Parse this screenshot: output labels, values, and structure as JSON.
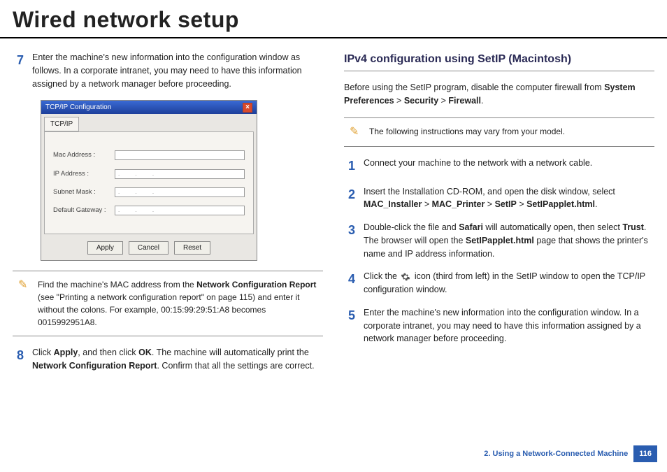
{
  "title": "Wired network setup",
  "left": {
    "step7": {
      "num": "7",
      "text": "Enter the machine's new information into the configuration window as follows. In a corporate intranet, you may need to have this information assigned by a network manager before proceeding."
    },
    "dialog": {
      "title": "TCP/IP Configuration",
      "tab": "TCP/IP",
      "rows": {
        "mac": "Mac Address :",
        "ip": "IP Address :",
        "subnet": "Subnet Mask :",
        "gateway": "Default Gateway :"
      },
      "dots": ". . .",
      "buttons": {
        "apply": "Apply",
        "cancel": "Cancel",
        "reset": "Reset"
      }
    },
    "note": {
      "t1": "Find the machine's MAC address from the ",
      "b1": "Network Configuration Report",
      "t2": " (see \"Printing a network configuration report\" on page 115) and enter it without the colons. For example, 00:15:99:29:51:A8 becomes 0015992951A8."
    },
    "step8": {
      "num": "8",
      "t1": "Click ",
      "b1": "Apply",
      "t2": ", and then click ",
      "b2": "OK",
      "t3": ". The machine will automatically print the ",
      "b3": "Network Configuration Report",
      "t4": ". Confirm that all the settings are correct."
    }
  },
  "right": {
    "heading": "IPv4 configuration using SetIP (Macintosh)",
    "intro": {
      "t1": "Before using the SetIP program, disable the computer firewall from ",
      "b1": "System Preferences",
      "gt1": " > ",
      "b2": "Security",
      "gt2": " > ",
      "b3": "Firewall",
      "t2": "."
    },
    "note": "The following instructions may vary from your model.",
    "step1": {
      "num": "1",
      "text": "Connect your machine to the network with a network cable."
    },
    "step2": {
      "num": "2",
      "t1": "Insert the Installation CD-ROM, and open the disk window, select ",
      "b1": "MAC_Installer",
      "gt1": " > ",
      "b2": "MAC_Printer",
      "gt2": " > ",
      "b3": "SetIP",
      "gt3": " > ",
      "b4": "SetIPapplet.html",
      "t2": "."
    },
    "step3": {
      "num": "3",
      "t1": "Double-click the file and ",
      "b1": "Safari",
      "t2": " will automatically open, then select ",
      "b2": "Trust",
      "t3": ". The browser will open the ",
      "b3": "SetIPapplet.html",
      "t4": " page that shows the printer's name and IP address information."
    },
    "step4": {
      "num": "4",
      "t1": "Click the ",
      "t2": " icon (third from left) in the SetIP window to open the TCP/IP configuration window."
    },
    "step5": {
      "num": "5",
      "text": "Enter the machine's new information into the configuration window. In a corporate intranet, you may need to have this information assigned by a network manager before proceeding."
    }
  },
  "footer": {
    "chapter": "2.  Using a Network-Connected Machine",
    "page": "116"
  }
}
